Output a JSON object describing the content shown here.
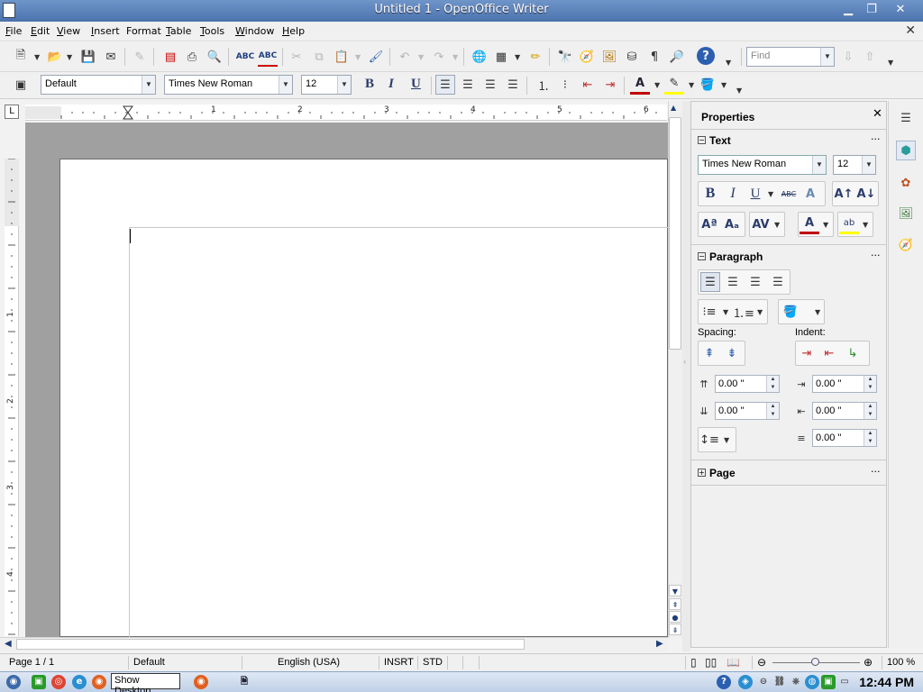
{
  "window": {
    "title": "Untitled 1 - OpenOffice Writer",
    "minimize": "▁",
    "restore": "❐",
    "close": "✕",
    "doc_close": "✕"
  },
  "menubar": {
    "items": [
      {
        "key": "F",
        "rest": "ile"
      },
      {
        "key": "E",
        "rest": "dit"
      },
      {
        "key": "V",
        "rest": "iew"
      },
      {
        "key": "I",
        "rest": "nsert"
      },
      {
        "key": "F",
        "rest": "ormat",
        "pre": ""
      },
      {
        "key": "T",
        "rest": "able"
      },
      {
        "key": "T",
        "rest": "ools"
      },
      {
        "key": "W",
        "rest": "indow"
      },
      {
        "key": "H",
        "rest": "elp"
      }
    ]
  },
  "toolbar": {
    "find_placeholder": "Find",
    "paragraph_style": "Default",
    "font_name": "Times New Roman",
    "font_size": "12",
    "bold": "B",
    "italic": "I",
    "underline": "U",
    "font_color_letter": "A"
  },
  "ruler": {
    "h_numbers": [
      "1",
      "2",
      "3",
      "4",
      "5",
      "6"
    ],
    "v_numbers": [
      "1",
      "2",
      "3",
      "4"
    ],
    "corner": "L"
  },
  "sidebar": {
    "title": "Properties",
    "close": "✕",
    "text_section": {
      "title": "Text",
      "font_name": "Times New Roman",
      "font_size": "12",
      "more": "···"
    },
    "paragraph_section": {
      "title": "Paragraph",
      "more": "···",
      "spacing_label": "Spacing:",
      "indent_label": "Indent:",
      "above_spacing": "0.00 \"",
      "below_spacing": "0.00 \"",
      "before_indent": "0.00 \"",
      "after_indent": "0.00 \"",
      "first_line_indent": "0.00 \""
    },
    "page_section": {
      "title": "Page",
      "more": "···"
    }
  },
  "statusbar": {
    "page": "Page 1 / 1",
    "style": "Default",
    "language": "English (USA)",
    "insert_mode": "INSRT",
    "selection_mode": "STD",
    "zoom": "100 %"
  },
  "taskbar": {
    "tooltip": "Show Desktop",
    "clock": "12:44 PM"
  }
}
